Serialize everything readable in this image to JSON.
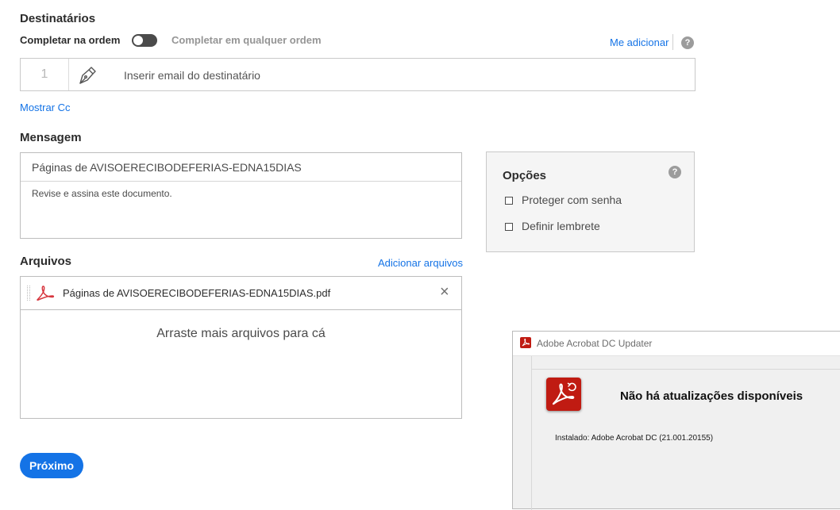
{
  "recipients": {
    "title": "Destinatários",
    "toggle_on_label": "Completar na ordem",
    "toggle_off_label": "Completar em qualquer ordem",
    "add_me": "Me adicionar",
    "help": "?",
    "number": "1",
    "email_placeholder": "Inserir email do destinatário",
    "show_cc": "Mostrar Cc"
  },
  "message": {
    "title": "Mensagem",
    "subject": "Páginas de AVISOERECIBODEFERIAS-EDNA15DIAS",
    "body": "Revise e assina este documento."
  },
  "options": {
    "title": "Opções",
    "help": "?",
    "items": [
      {
        "label": "Proteger com senha",
        "checked": false
      },
      {
        "label": "Definir lembrete",
        "checked": false
      }
    ]
  },
  "files": {
    "title": "Arquivos",
    "add_files": "Adicionar arquivos",
    "items": [
      {
        "name": "Páginas de AVISOERECIBODEFERIAS-EDNA15DIAS.pdf",
        "icon": "pdf-icon"
      }
    ],
    "remove": "×",
    "drop_hint": "Arraste mais arquivos para cá"
  },
  "next_button": "Próximo",
  "updater": {
    "window_title": "Adobe Acrobat DC Updater",
    "heading": "Não há atualizações disponíveis",
    "installed": "Instalado: Adobe Acrobat DC (21.001.20155)"
  },
  "colors": {
    "accent": "#1473e6",
    "adobe_red": "#c01b12"
  }
}
